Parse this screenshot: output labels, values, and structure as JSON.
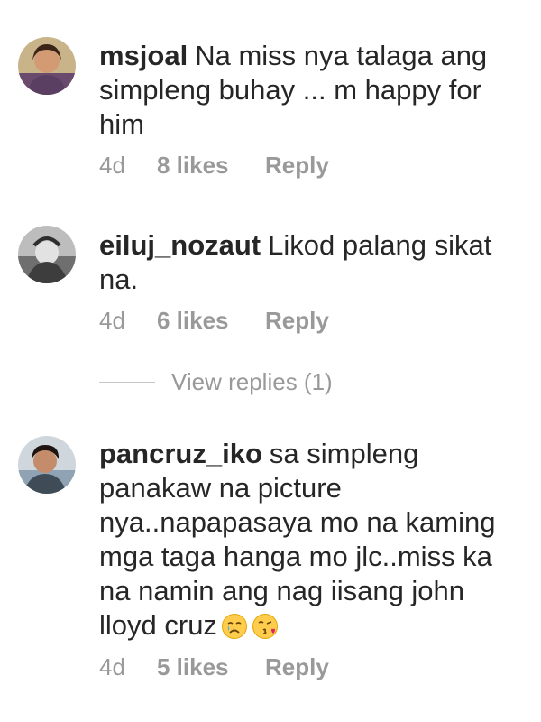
{
  "comments": [
    {
      "username": "msjoal",
      "text": "Na miss nya talaga ang simpleng buhay ... m happy for him",
      "time": "4d",
      "likes": "8 likes",
      "reply": "Reply",
      "avatar_icon": "user-avatar-woman-icon"
    },
    {
      "username": "eiluj_nozaut",
      "text": "Likod palang sikat na.",
      "time": "4d",
      "likes": "6 likes",
      "reply": "Reply",
      "avatar_icon": "user-avatar-grayscale-icon"
    },
    {
      "username": "pancruz_iko",
      "text": "sa simpleng panakaw na picture nya..napapasaya mo na kaming mga taga hanga mo jlc..miss ka na namin ang nag iisang john lloyd cruz",
      "emojis": [
        "crying-face",
        "face-blowing-kiss"
      ],
      "time": "4d",
      "likes": "5 likes",
      "reply": "Reply",
      "avatar_icon": "user-avatar-man-icon"
    }
  ],
  "view_replies": "View replies (1)",
  "colors": {
    "text": "#262626",
    "meta": "#999999",
    "divider": "#c7c7c7"
  }
}
